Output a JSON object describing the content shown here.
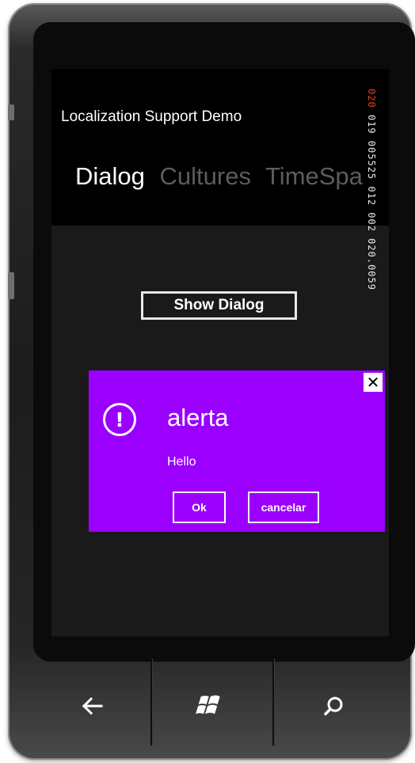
{
  "app": {
    "title": "Localization Support Demo"
  },
  "pivot": {
    "items": [
      {
        "label": "Dialog",
        "active": true
      },
      {
        "label": "Cultures",
        "active": false
      },
      {
        "label": "TimeSpa",
        "active": false
      }
    ]
  },
  "counter": {
    "red_text": "020",
    "white_text": " 019 005525 012 002 020.0059"
  },
  "main": {
    "show_dialog_label": "Show Dialog"
  },
  "dialog": {
    "close_label": "✕",
    "icon_label": "!",
    "title": "alerta",
    "message": "Hello",
    "ok_label": "Ok",
    "cancel_label": "cancelar",
    "background_color": "#9b00ff"
  },
  "hardware_buttons": {
    "back": "back-arrow-icon",
    "start": "windows-logo-icon",
    "search": "search-icon"
  },
  "colors": {
    "accent": "#9b00ff",
    "counter_red": "#e0401a"
  }
}
